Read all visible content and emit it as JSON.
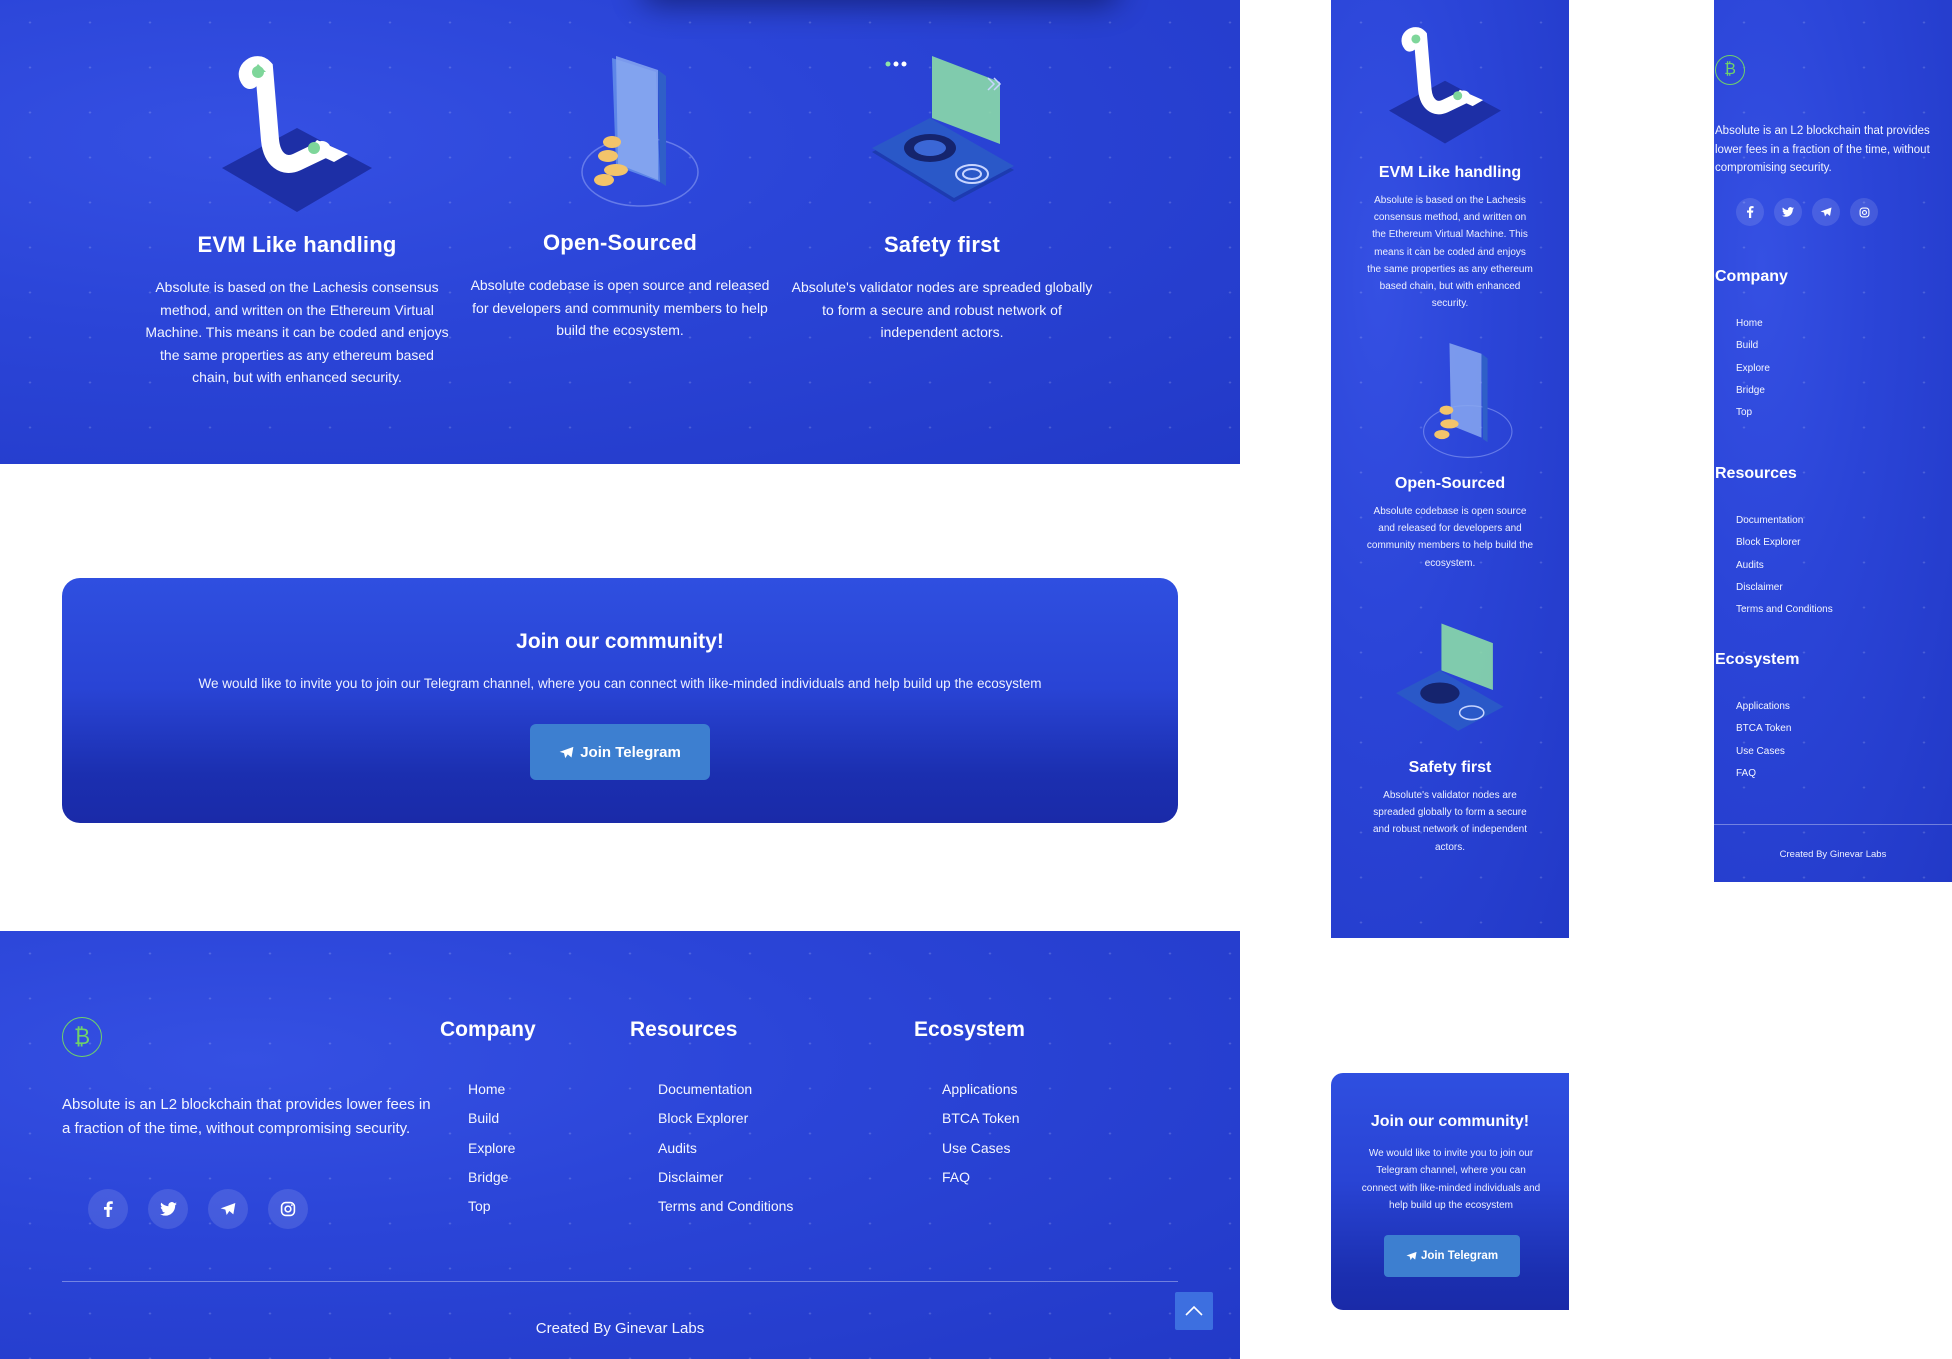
{
  "colors": {
    "brand_blue": "#2b45d8",
    "button_blue": "#3d7fd0",
    "logo_green": "#6fd16a"
  },
  "features": [
    {
      "title": "EVM Like handling",
      "text": "Absolute is based on the Lachesis consensus method, and written on the Ethereum Virtual Machine. This means it can be coded and enjoys the same properties as any ethereum based chain, but with enhanced security.",
      "icon": "receipt-illustration"
    },
    {
      "title": "Open-Sourced",
      "text": "Absolute codebase is open source and released for developers and community members to help build the ecosystem.",
      "icon": "phone-coins-illustration"
    },
    {
      "title": "Safety first",
      "text": "Absolute's validator nodes are spreaded globally to form a secure and robust network of independent actors.",
      "icon": "fingerprint-card-illustration"
    }
  ],
  "community": {
    "title": "Join our community!",
    "text": "We would like to invite you to join our Telegram channel, where you can connect with like-minded individuals and help build up the ecosystem",
    "button_label": "Join Telegram"
  },
  "footer": {
    "logo_icon": "bitcoin-logo-icon",
    "description": "Absolute is an L2 blockchain that provides lower fees in a fraction of the time, without compromising security.",
    "socials": [
      "facebook-icon",
      "twitter-icon",
      "telegram-icon",
      "instagram-icon"
    ],
    "columns": [
      {
        "title": "Company",
        "items": [
          "Home",
          "Build",
          "Explore",
          "Bridge",
          "Top"
        ]
      },
      {
        "title": "Resources",
        "items": [
          "Documentation",
          "Block Explorer",
          "Audits",
          "Disclaimer",
          "Terms and Conditions"
        ]
      },
      {
        "title": "Ecosystem",
        "items": [
          "Applications",
          "BTCA Token",
          "Use Cases",
          "FAQ"
        ]
      }
    ],
    "credit": "Created By Ginevar Labs"
  }
}
